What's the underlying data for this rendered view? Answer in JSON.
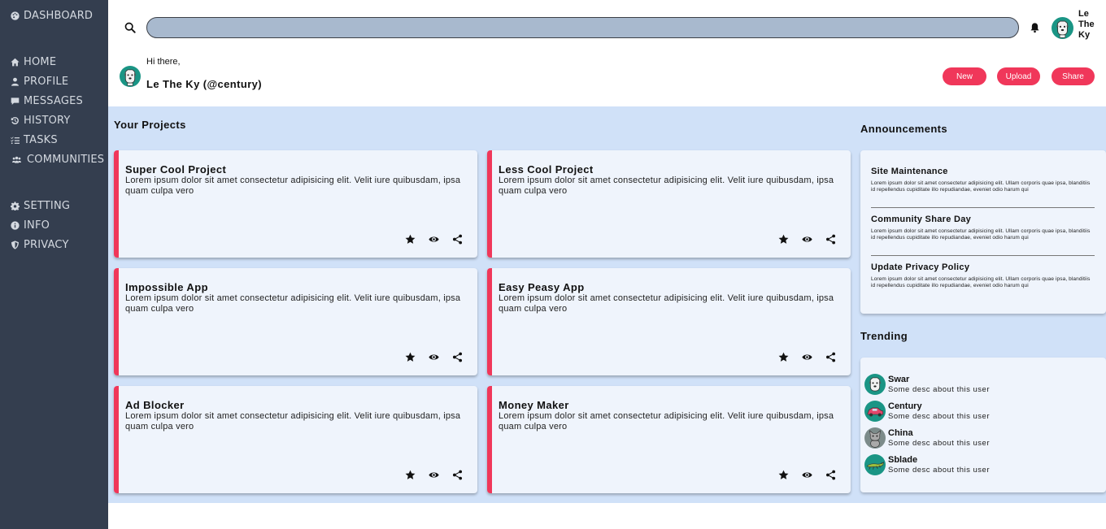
{
  "sidebar": {
    "dashboard": "DASHBOARD",
    "items": [
      "HOME",
      "PROFILE",
      "MESSAGES",
      "HISTORY",
      "TASKS",
      "COMMUNITIES"
    ],
    "footer_items": [
      "SETTING",
      "INFO",
      "PRIVACY"
    ]
  },
  "header": {
    "search_placeholder": "",
    "user_short": "Le The Ky"
  },
  "greeting": {
    "hi": "Hi there,",
    "name": "Le The Ky (@century)"
  },
  "actions": {
    "new": "New",
    "upload": "Upload",
    "share": "Share"
  },
  "projects": {
    "title": "Your Projects",
    "items": [
      {
        "title": "Super Cool Project",
        "desc": "Lorem ipsum dolor sit amet consectetur adipisicing elit. Velit iure quibusdam, ipsa quam culpa vero"
      },
      {
        "title": "Less Cool Project",
        "desc": "Lorem ipsum dolor sit amet consectetur adipisicing elit. Velit iure quibusdam, ipsa quam culpa vero"
      },
      {
        "title": "Impossible App",
        "desc": "Lorem ipsum dolor sit amet consectetur adipisicing elit. Velit iure quibusdam, ipsa quam culpa vero"
      },
      {
        "title": "Easy Peasy App",
        "desc": "Lorem ipsum dolor sit amet consectetur adipisicing elit. Velit iure quibusdam, ipsa quam culpa vero"
      },
      {
        "title": "Ad Blocker",
        "desc": "Lorem ipsum dolor sit amet consectetur adipisicing elit. Velit iure quibusdam, ipsa quam culpa vero"
      },
      {
        "title": "Money Maker",
        "desc": "Lorem ipsum dolor sit amet consectetur adipisicing elit. Velit iure quibusdam, ipsa quam culpa vero"
      }
    ]
  },
  "announcements": {
    "title": "Announcements",
    "items": [
      {
        "title": "Site Maintenance",
        "body": "Lorem ipsum dolor sit amet consectetur adipisicing elit. Ullam corporis quae ipsa, blanditiis id repellendus cupiditate illo repudiandae, eveniet odio harum qui"
      },
      {
        "title": "Community Share Day",
        "body": "Lorem ipsum dolor sit amet consectetur adipisicing elit. Ullam corporis quae ipsa, blanditiis id repellendus cupiditate illo repudiandae, eveniet odio harum qui"
      },
      {
        "title": "Update Privacy Policy",
        "body": "Lorem ipsum dolor sit amet consectetur adipisicing elit. Ullam corporis quae ipsa, blanditiis id repellendus cupiditate illo repudiandae, eveniet odio harum qui"
      }
    ]
  },
  "trending": {
    "title": "Trending",
    "users": [
      {
        "name": "Swar",
        "desc": "Some desc about this user",
        "icon": "dog-icon"
      },
      {
        "name": "Century",
        "desc": "Some desc about this user",
        "icon": "car-icon"
      },
      {
        "name": "China",
        "desc": "Some desc about this user",
        "icon": "cat-icon"
      },
      {
        "name": "Sblade",
        "desc": "Some desc about this user",
        "icon": "lizard-icon"
      }
    ]
  },
  "colors": {
    "sidebar": "#343e4f",
    "accent": "#f0375a",
    "main_bg": "#d0e1f8",
    "card_bg": "#eff4fc",
    "search_bg": "#a8b9ce",
    "avatar_bg": "#1a9585"
  }
}
